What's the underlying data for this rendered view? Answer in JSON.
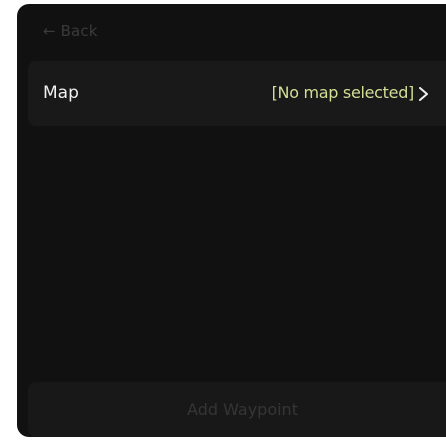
{
  "header": {
    "back_arrow": "←",
    "back_label": "Back"
  },
  "map_selector": {
    "label": "Map",
    "value": "[No map selected]",
    "chevron_icon": "chevron-right-icon"
  },
  "footer": {
    "add_waypoint_label": "Add Waypoint",
    "add_waypoint_enabled": false
  },
  "colors": {
    "panel_background": "#111111",
    "row_background": "#191919",
    "accent": "#d3de96",
    "disabled_text": "#353535"
  }
}
